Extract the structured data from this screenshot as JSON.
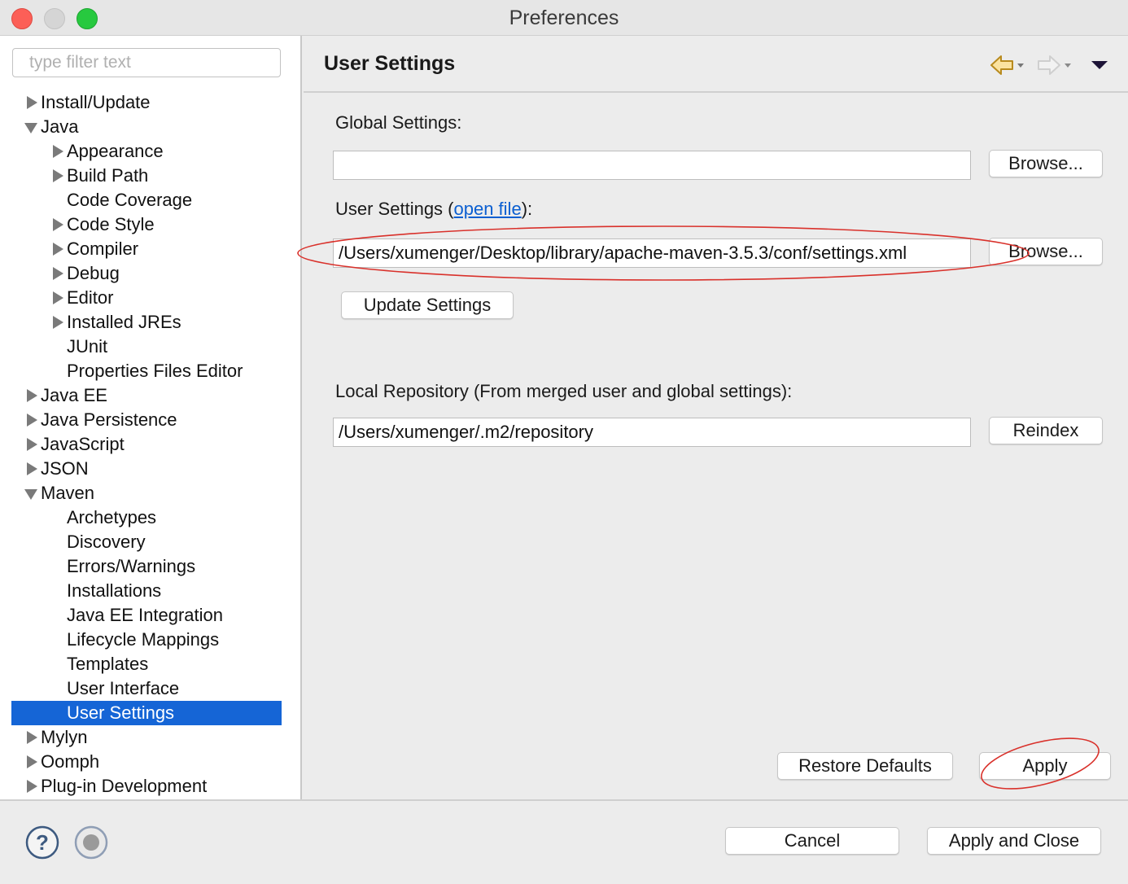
{
  "window": {
    "title": "Preferences"
  },
  "sidebar": {
    "filter_placeholder": "type filter text",
    "items": [
      {
        "label": "Install/Update",
        "level": 0,
        "state": "collapsed"
      },
      {
        "label": "Java",
        "level": 0,
        "state": "expanded"
      },
      {
        "label": "Appearance",
        "level": 1,
        "state": "collapsed"
      },
      {
        "label": "Build Path",
        "level": 1,
        "state": "collapsed"
      },
      {
        "label": "Code Coverage",
        "level": 1,
        "state": "leaf"
      },
      {
        "label": "Code Style",
        "level": 1,
        "state": "collapsed"
      },
      {
        "label": "Compiler",
        "level": 1,
        "state": "collapsed"
      },
      {
        "label": "Debug",
        "level": 1,
        "state": "collapsed"
      },
      {
        "label": "Editor",
        "level": 1,
        "state": "collapsed"
      },
      {
        "label": "Installed JREs",
        "level": 1,
        "state": "collapsed"
      },
      {
        "label": "JUnit",
        "level": 1,
        "state": "leaf"
      },
      {
        "label": "Properties Files Editor",
        "level": 1,
        "state": "leaf"
      },
      {
        "label": "Java EE",
        "level": 0,
        "state": "collapsed"
      },
      {
        "label": "Java Persistence",
        "level": 0,
        "state": "collapsed"
      },
      {
        "label": "JavaScript",
        "level": 0,
        "state": "collapsed"
      },
      {
        "label": "JSON",
        "level": 0,
        "state": "collapsed"
      },
      {
        "label": "Maven",
        "level": 0,
        "state": "expanded"
      },
      {
        "label": "Archetypes",
        "level": 1,
        "state": "leaf"
      },
      {
        "label": "Discovery",
        "level": 1,
        "state": "leaf"
      },
      {
        "label": "Errors/Warnings",
        "level": 1,
        "state": "leaf"
      },
      {
        "label": "Installations",
        "level": 1,
        "state": "leaf"
      },
      {
        "label": "Java EE Integration",
        "level": 1,
        "state": "leaf"
      },
      {
        "label": "Lifecycle Mappings",
        "level": 1,
        "state": "leaf"
      },
      {
        "label": "Templates",
        "level": 1,
        "state": "leaf"
      },
      {
        "label": "User Interface",
        "level": 1,
        "state": "leaf"
      },
      {
        "label": "User Settings",
        "level": 1,
        "state": "leaf",
        "selected": true
      },
      {
        "label": "Mylyn",
        "level": 0,
        "state": "collapsed"
      },
      {
        "label": "Oomph",
        "level": 0,
        "state": "collapsed"
      },
      {
        "label": "Plug-in Development",
        "level": 0,
        "state": "collapsed"
      }
    ]
  },
  "main": {
    "title": "User Settings",
    "nav_icons": [
      "back-arrow-icon",
      "forward-arrow-icon",
      "view-menu-icon"
    ],
    "global_settings": {
      "label": "Global Settings:",
      "value": "",
      "browse_label": "Browse..."
    },
    "user_settings": {
      "label_prefix": "User Settings (",
      "link_text": "open file",
      "label_suffix": "):",
      "value": "/Users/xumenger/Desktop/library/apache-maven-3.5.3/conf/settings.xml",
      "browse_label": "Browse..."
    },
    "update_settings_label": "Update Settings",
    "local_repo": {
      "label": "Local Repository (From merged user and global settings):",
      "value": "/Users/xumenger/.m2/repository",
      "reindex_label": "Reindex"
    },
    "restore_defaults_label": "Restore Defaults",
    "apply_label": "Apply"
  },
  "footer": {
    "help_icon": "help-icon",
    "record_icon": "record-icon",
    "cancel_label": "Cancel",
    "apply_close_label": "Apply and Close"
  },
  "colors": {
    "selection": "#1565d6",
    "link": "#0b5fd1",
    "annotation": "#d9312b",
    "close": "#fc5f57",
    "maximize": "#27c93f"
  }
}
